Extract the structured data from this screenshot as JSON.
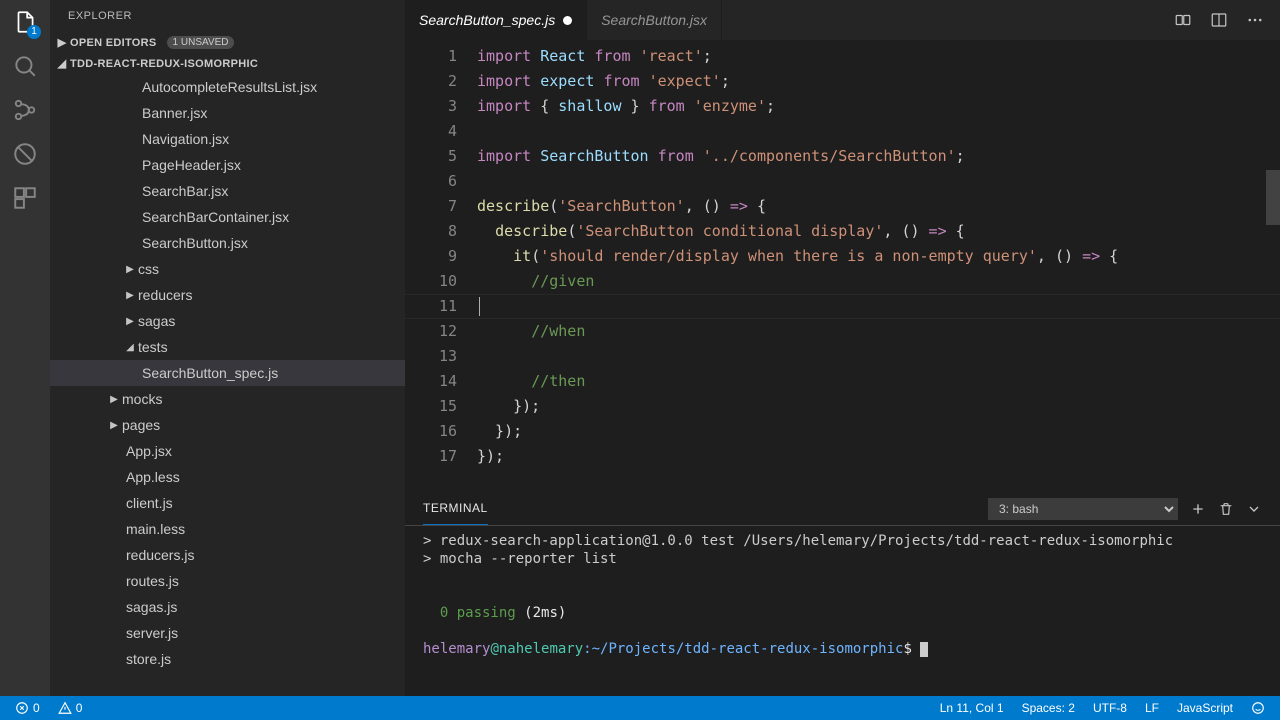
{
  "activity": {
    "explorer_badge": "1"
  },
  "sidebar": {
    "title": "EXPLORER",
    "open_editors_label": "OPEN EDITORS",
    "open_editors_pill": "1 UNSAVED",
    "project_name": "TDD-REACT-REDUX-ISOMORPHIC",
    "tree": {
      "components": [
        "AutocompleteResultsList.jsx",
        "Banner.jsx",
        "Navigation.jsx",
        "PageHeader.jsx",
        "SearchBar.jsx",
        "SearchBarContainer.jsx",
        "SearchButton.jsx"
      ],
      "folders_l1": [
        "css",
        "reducers",
        "sagas"
      ],
      "tests_label": "tests",
      "tests_file": "SearchButton_spec.js",
      "folders_l0": [
        "mocks",
        "pages"
      ],
      "root_files": [
        "App.jsx",
        "App.less",
        "client.js",
        "main.less",
        "reducers.js",
        "routes.js",
        "sagas.js",
        "server.js",
        "store.js"
      ]
    }
  },
  "tabs": {
    "active": "SearchButton_spec.js",
    "inactive": "SearchButton.jsx"
  },
  "editor": {
    "line_numbers": [
      "1",
      "2",
      "3",
      "4",
      "5",
      "6",
      "7",
      "8",
      "9",
      "10",
      "11",
      "12",
      "13",
      "14",
      "15",
      "16",
      "17"
    ]
  },
  "terminal": {
    "title": "TERMINAL",
    "select": "3: bash",
    "line1": "> redux-search-application@1.0.0 test /Users/helemary/Projects/tdd-react-redux-isomorphic",
    "line2": "> mocha --reporter list",
    "pass": "  0 passing ",
    "pass_time": "(2ms)",
    "prompt_user": "helemary",
    "prompt_host": "@nahelemary",
    "prompt_path": ":~/Projects/tdd-react-redux-isomorphic",
    "prompt_end": "$ "
  },
  "status": {
    "errors": "0",
    "warnings": "0",
    "lncol": "Ln 11, Col 1",
    "spaces": "Spaces: 2",
    "encoding": "UTF-8",
    "eol": "LF",
    "lang": "JavaScript"
  }
}
